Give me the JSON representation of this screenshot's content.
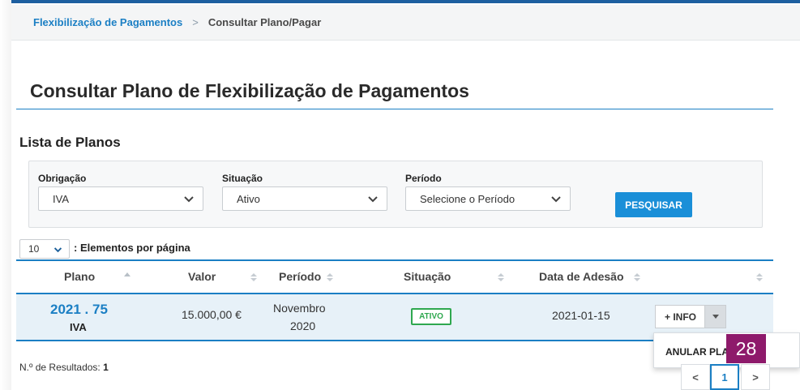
{
  "breadcrumb": {
    "root": "Flexibilização de Pagamentos",
    "separator": ">",
    "current": "Consultar Plano/Pagar"
  },
  "page_title": "Consultar Plano de Flexibilização de Pagamentos",
  "section_title": "Lista de Planos",
  "filters": {
    "obrigacao": {
      "label": "Obrigação",
      "value": "IVA"
    },
    "situacao": {
      "label": "Situação",
      "value": "Ativo"
    },
    "periodo": {
      "label": "Período",
      "value": "Selecione o Período"
    },
    "search_label": "PESQUISAR"
  },
  "pagination_size": {
    "value": "10",
    "label": ": Elementos por página"
  },
  "table": {
    "headers": [
      "Plano",
      "Valor",
      "Período",
      "Situação",
      "Data de Adesão"
    ],
    "rows": [
      {
        "plano_number": "2021 . 75",
        "obrigacao": "IVA",
        "valor": "15.000,00 €",
        "periodo_line1": "Novembro",
        "periodo_line2": "2020",
        "situacao": "ATIVO",
        "data_adesao": "2021-01-15",
        "info_label": "+ INFO"
      }
    ]
  },
  "dropdown_menu": {
    "item": "ANULAR PLANO"
  },
  "overlay_badge": "28",
  "results": {
    "label": "N.º de Resultados:",
    "count": "1"
  },
  "pager": {
    "prev": "<",
    "page": "1",
    "next": ">"
  },
  "colors": {
    "primary": "#1b7fc4",
    "button": "#1a8fd8",
    "active_status": "#2fa84f",
    "badge": "#8e1a6b",
    "row_highlight": "#e7f1f8"
  }
}
